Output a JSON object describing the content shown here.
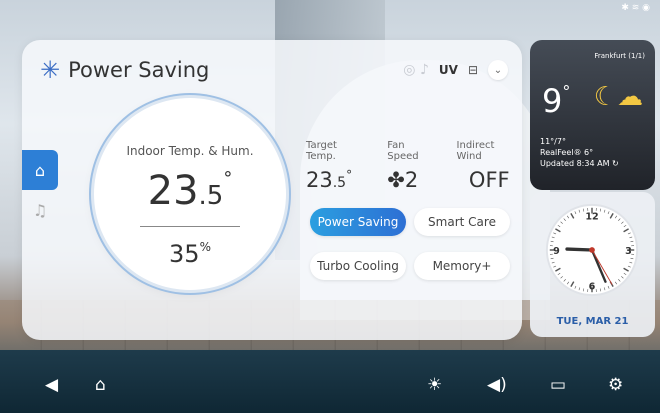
{
  "status_bar": {
    "icons": [
      "bluetooth-icon",
      "wifi-icon",
      "wifi-signal-icon"
    ],
    "text": "✱ ≋ ◉"
  },
  "header": {
    "title": "Power Saving",
    "uv_label": "UV",
    "mode_icon": "snowflake-icon"
  },
  "side_tabs": [
    {
      "name": "home-icon",
      "active": true
    },
    {
      "name": "bell-icon",
      "active": false
    }
  ],
  "indoor": {
    "label": "Indoor Temp. & Hum.",
    "temp_int": "23",
    "temp_dec": ".5",
    "temp_unit": "°",
    "humidity": "35",
    "hum_unit": "%"
  },
  "controls": {
    "target": {
      "label": "Target Temp.",
      "value_int": "23",
      "value_dec": ".5",
      "unit": "°"
    },
    "fan": {
      "label": "Fan Speed",
      "icon": "fan-icon",
      "value": "2"
    },
    "wind": {
      "label": "Indirect Wind",
      "value": "OFF"
    }
  },
  "modes": [
    {
      "label": "Power Saving",
      "active": true
    },
    {
      "label": "Smart Care",
      "active": false
    },
    {
      "label": "Turbo Cooling",
      "active": false
    },
    {
      "label": "Memory+",
      "active": false
    }
  ],
  "weather": {
    "city": "Frankfurt (1/1)",
    "temp": "9",
    "unit": "°",
    "hi_lo": "11°/7°",
    "real_feel": "RealFeel® 6°",
    "updated": "Updated 8:34 AM",
    "icon": "moon-cloud-icon"
  },
  "clock": {
    "date": "TUE, MAR 21",
    "n12": "12",
    "n3": "3",
    "n6": "6",
    "n9": "9"
  },
  "bottom_bar": [
    "back-icon",
    "home-icon",
    "brightness-icon",
    "volume-icon",
    "screen-mirror-icon",
    "settings-icon"
  ],
  "colors": {
    "accent": "#2d7fd6",
    "active_button": "#2b9fe0",
    "date_text": "#2a5ea8"
  }
}
